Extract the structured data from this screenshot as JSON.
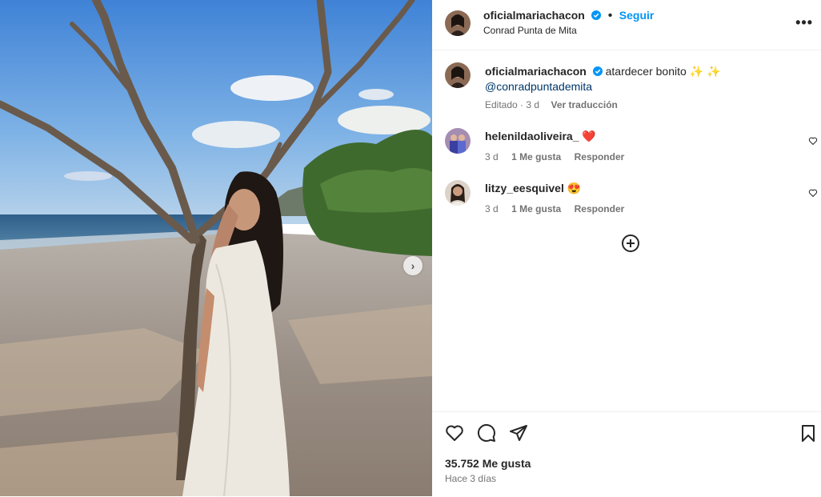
{
  "post": {
    "username": "oficialmariachacon",
    "follow_label": "Seguir",
    "separator": "•",
    "location": "Conrad Punta de Mita",
    "more_icon": "more-horizontal-icon",
    "carousel_next_icon": "chevron-right-icon"
  },
  "caption": {
    "username": "oficialmariachacon",
    "text": "atardecer bonito",
    "emoji": "✨ ✨",
    "mention": "@conradpuntademita",
    "edited": "Editado · 3 d",
    "translate": "Ver traducción"
  },
  "comments": [
    {
      "username": "helenildaoliveira_",
      "text": "❤️",
      "time": "3 d",
      "likes": "1 Me gusta",
      "reply": "Responder"
    },
    {
      "username": "litzy_eesquivel",
      "text": "😍",
      "time": "3 d",
      "likes": "1 Me gusta",
      "reply": "Responder"
    }
  ],
  "load_more_icon": "plus-circle-icon",
  "actions": {
    "like_count": "35.752 Me gusta",
    "ago": "Hace 3 días",
    "icons": [
      "heart-icon",
      "comment-icon",
      "share-icon",
      "bookmark-icon"
    ]
  },
  "colors": {
    "accent": "#0095f6",
    "heart": "#ed4956",
    "verified": "#0095f6"
  }
}
